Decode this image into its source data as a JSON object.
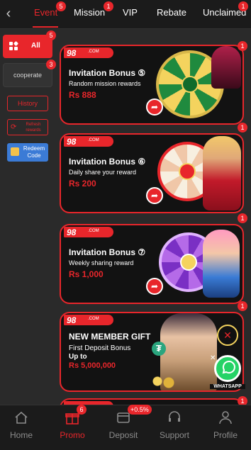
{
  "top_nav": {
    "back_icon": "chevron-left-icon",
    "tabs": [
      {
        "label": "Event",
        "badge": "5",
        "active": true
      },
      {
        "label": "Mission",
        "badge": "1"
      },
      {
        "label": "VIP"
      },
      {
        "label": "Rebate"
      },
      {
        "label": "Unclaimed",
        "badge": "1"
      }
    ]
  },
  "sidebar": {
    "all": {
      "label": "All",
      "badge": "5"
    },
    "cooperate": {
      "label": "cooperate",
      "badge": "3"
    },
    "history": "History",
    "refresh": "Refresh rewards",
    "redeem": "Redeem Code"
  },
  "cards": [
    {
      "logo": "98",
      "logo_suffix": ".COM",
      "title": "Invitation Bonus ⑤",
      "subtitle": "Random mission rewards",
      "amount": "Rs 888",
      "badge": "1"
    },
    {
      "logo": "98",
      "logo_suffix": ".COM",
      "title": "Invitation Bonus ⑥",
      "subtitle": "Daily share your reward",
      "amount": "Rs 200",
      "badge": "1"
    },
    {
      "logo": "98",
      "logo_suffix": ".COM",
      "title": "Invitation Bonus ⑦",
      "subtitle": "Weekly sharing reward",
      "amount": "Rs 1,000",
      "badge": "1"
    },
    {
      "logo": "98",
      "logo_suffix": ".COM",
      "title": "NEW MEMBER GIFT",
      "subtitle": "First Deposit Bonus",
      "upto": "Up to",
      "amount": "Rs 5,000,000",
      "badge": "1"
    }
  ],
  "whatsapp": {
    "label": "WHATSAPP"
  },
  "bottom_nav": [
    {
      "label": "Home",
      "icon": "home-icon"
    },
    {
      "label": "Promo",
      "icon": "gift-icon",
      "badge": "6",
      "active": true
    },
    {
      "label": "Deposit",
      "icon": "deposit-icon",
      "badge": "+0.5%"
    },
    {
      "label": "Support",
      "icon": "headset-icon"
    },
    {
      "label": "Profile",
      "icon": "user-icon"
    }
  ],
  "colors": {
    "accent": "#e8262b",
    "background": "#2a2a2a",
    "bar": "#1b1b1b"
  }
}
